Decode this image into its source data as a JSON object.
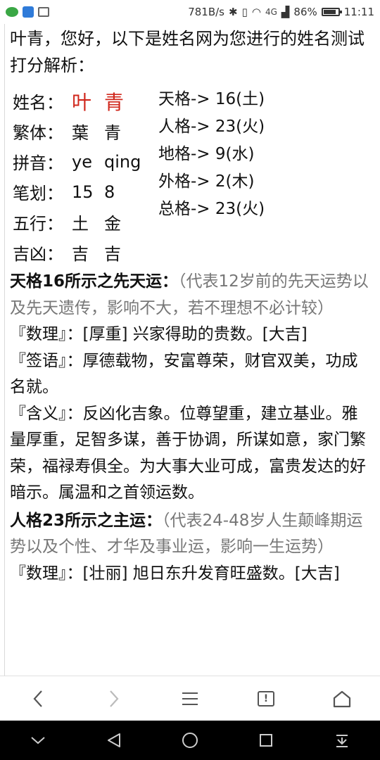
{
  "status_bar": {
    "speed": "781B/s",
    "signal_text": "4G",
    "battery": "86%",
    "battery_level": 0.86,
    "time": "11:11"
  },
  "intro": "叶青，您好，以下是姓名网为您进行的姓名测试打分解析：",
  "name_table": {
    "rows": [
      {
        "label": "姓名：",
        "v1": "叶",
        "v2": "青"
      },
      {
        "label": "繁体：",
        "v1": "葉",
        "v2": "青"
      },
      {
        "label": "拼音：",
        "v1": "ye",
        "v2": "qing"
      },
      {
        "label": "笔划：",
        "v1": "15",
        "v2": "8"
      },
      {
        "label": "五行：",
        "v1": "土",
        "v2": "金"
      },
      {
        "label": "吉凶：",
        "v1": "吉",
        "v2": "吉"
      }
    ],
    "ge": [
      "天格-> 16(土)",
      "人格-> 23(火)",
      "地格-> 9(水)",
      "外格-> 2(木)",
      "总格-> 23(火)"
    ]
  },
  "tiange": {
    "head": "天格16所示之先天运：",
    "note": "（代表12岁前的先天运势以及先天遗传，影响不大，若不理想不必计较）",
    "shuli_label": "『数理』：",
    "shuli": "[厚重] 兴家得助的贵数。[大吉]",
    "qianyu_label": "『签语』：",
    "qianyu": "厚德载物，安富尊荣，财官双美，功成名就。",
    "hanyi_label": "『含义』：",
    "hanyi": "反凶化吉象。位尊望重，建立基业。雅量厚重，足智多谋，善于协调，所谋如意，家门繁荣，福禄寿俱全。为大事大业可成，富贵发达的好暗示。属温和之首领运数。"
  },
  "renge": {
    "head": "人格23所示之主运：",
    "note": "（代表24-48岁人生颠峰期运势以及个性、才华及事业运，影响一生运势）",
    "shuli_label": "『数理』：",
    "shuli": "[壮丽] 旭日东升发育旺盛数。[大吉]"
  },
  "browser_nav": {
    "back": "‹",
    "forward": "›",
    "tab_count": "!"
  }
}
